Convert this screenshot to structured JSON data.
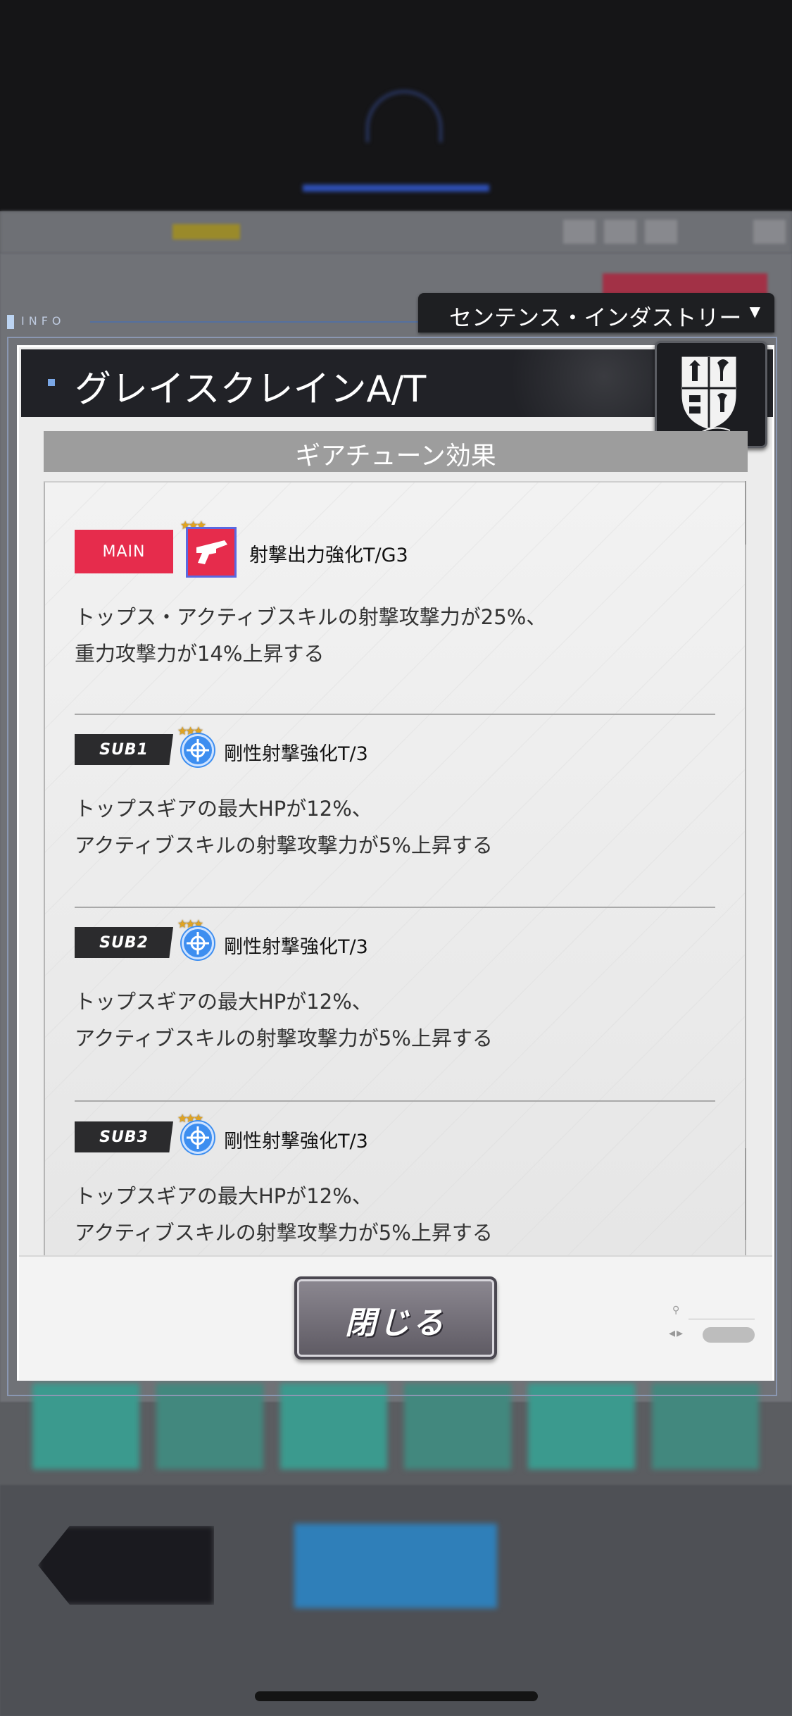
{
  "company": {
    "label": "センテンス・インダストリー"
  },
  "info": {
    "label": "INFO"
  },
  "modal": {
    "title": "グレイスクレインA/T",
    "section_title": "ギアチューン効果",
    "entries": [
      {
        "tag": "MAIN",
        "stars": "★★★",
        "skill": "射撃出力強化T/G3",
        "desc1": "トップス・アクティブスキルの射撃攻撃力が25%、",
        "desc2": "重力攻撃力が14%上昇する",
        "icon": "gun-icon"
      },
      {
        "tag": "SUB1",
        "stars": "★★★",
        "skill": "剛性射撃強化T/3",
        "desc1": "トップスギアの最大HPが12%、",
        "desc2": "アクティブスキルの射撃攻撃力が5%上昇する",
        "icon": "crosshair-icon"
      },
      {
        "tag": "SUB2",
        "stars": "★★★",
        "skill": "剛性射撃強化T/3",
        "desc1": "トップスギアの最大HPが12%、",
        "desc2": "アクティブスキルの射撃攻撃力が5%上昇する",
        "icon": "crosshair-icon"
      },
      {
        "tag": "SUB3",
        "stars": "★★★",
        "skill": "剛性射撃強化T/3",
        "desc1": "トップスギアの最大HPが12%、",
        "desc2": "アクティブスキルの射撃攻撃力が5%上昇する",
        "icon": "crosshair-icon"
      }
    ],
    "close_label": "閉じる"
  },
  "colors": {
    "main_tag": "#e62c4c",
    "sub_tag": "#2b2b2d",
    "header_bg": "#212227",
    "button_bg": "#6f6b75"
  }
}
